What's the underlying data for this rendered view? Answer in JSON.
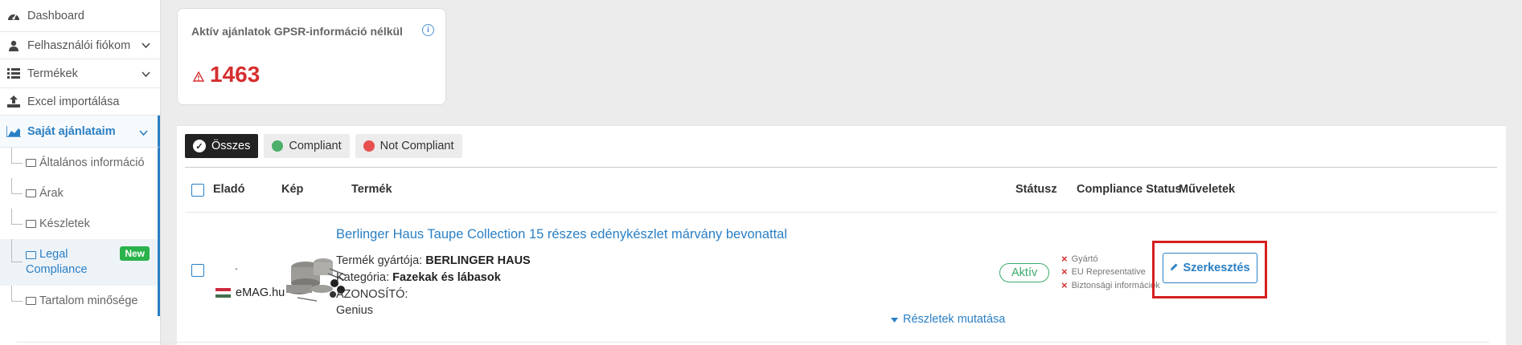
{
  "sidebar": {
    "items": [
      {
        "label": "Dashboard",
        "icon": "dashboard-icon"
      },
      {
        "label": "Felhasználói fiókom",
        "icon": "user-icon",
        "expandable": true
      },
      {
        "label": "Termékek",
        "icon": "list-icon",
        "expandable": true
      },
      {
        "label": "Excel importálása",
        "icon": "upload-icon"
      },
      {
        "label": "Saját ajánlataim",
        "icon": "chart-icon",
        "expandable": true,
        "active": true
      }
    ],
    "subitems": [
      {
        "label": "Általános információ"
      },
      {
        "label": "Árak"
      },
      {
        "label": "Készletek"
      },
      {
        "label": "Legal Compliance",
        "label_line1": "Legal",
        "label_line2": "Compliance",
        "badge": "New",
        "selected": true
      },
      {
        "label": "Tartalom minősége"
      }
    ]
  },
  "summary": {
    "title": "Aktív ajánlatok GPSR-információ nélkül",
    "value": "1463"
  },
  "filters": {
    "all": "Összes",
    "compliant": "Compliant",
    "not_compliant": "Not Compliant"
  },
  "table": {
    "headers": {
      "seller": "Eladó",
      "image": "Kép",
      "product": "Termék",
      "status": "Státusz",
      "compliance": "Compliance Status",
      "actions": "Műveletek"
    },
    "row": {
      "seller_dot": ".",
      "seller": "eMAG.hu",
      "title": "Berlinger Haus Taupe Collection 15 részes edénykészlet márvány bevonattal",
      "manufacturer_label": "Termék gyártója:",
      "manufacturer": "BERLINGER HAUS",
      "category_label": "Kategória:",
      "category": "Fazekak és lábasok",
      "id_label": "AZONOSÍTÓ:",
      "brand": "Genius",
      "status": "Aktív",
      "compliance_items": [
        "Gyártó",
        "EU Representative",
        "Biztonsági információk"
      ],
      "details_link": "Részletek mutatása",
      "edit_button": "Szerkesztés"
    }
  },
  "colors": {
    "accent": "#2a7fc4",
    "danger": "#d62f2f",
    "success": "#3bab6a",
    "compliant_dot": "#4caf6a",
    "not_compliant_dot": "#e85050"
  }
}
